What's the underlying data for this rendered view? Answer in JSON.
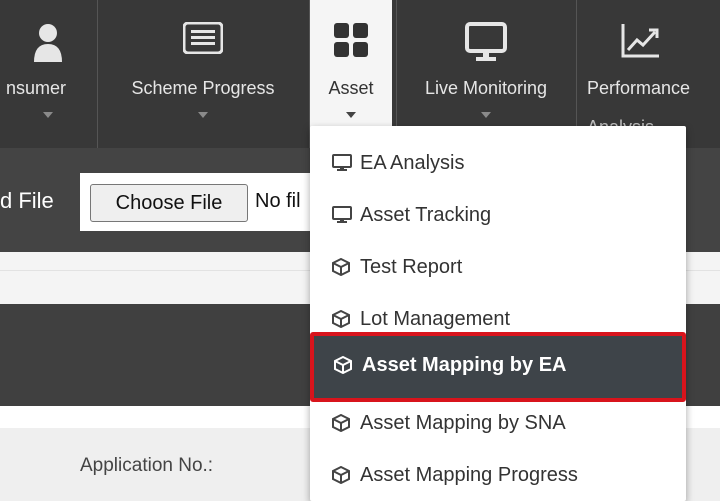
{
  "nav": {
    "items": [
      {
        "label": "nsumer",
        "icon": "user-icon"
      },
      {
        "label": "Scheme Progress",
        "icon": "list-card-icon"
      },
      {
        "label": "Asset",
        "icon": "grid-icon"
      },
      {
        "label": "Live Monitoring",
        "icon": "monitor-icon"
      },
      {
        "label": "Performance",
        "sub": "Analysis",
        "icon": "line-chart-icon"
      }
    ]
  },
  "upload": {
    "label": "d File",
    "button": "Choose File",
    "status": "No fil"
  },
  "form": {
    "application_label": "Application No.:"
  },
  "dropdown": {
    "items": [
      {
        "label": "EA Analysis",
        "icon": "monitor-icon"
      },
      {
        "label": "Asset Tracking",
        "icon": "monitor-icon"
      },
      {
        "label": "Test Report",
        "icon": "cube-icon"
      },
      {
        "label": "Lot Management",
        "icon": "cube-icon"
      },
      {
        "label": "Asset Mapping by EA",
        "icon": "cube-icon",
        "active": true
      },
      {
        "label": "Asset Mapping by SNA",
        "icon": "cube-icon"
      },
      {
        "label": "Asset Mapping Progress",
        "icon": "cube-icon"
      }
    ]
  },
  "colors": {
    "nav_bg": "#383838",
    "active_nav_bg": "#f5f5f5",
    "highlight_bg": "#3e4449",
    "highlight_border": "#d8141c"
  }
}
